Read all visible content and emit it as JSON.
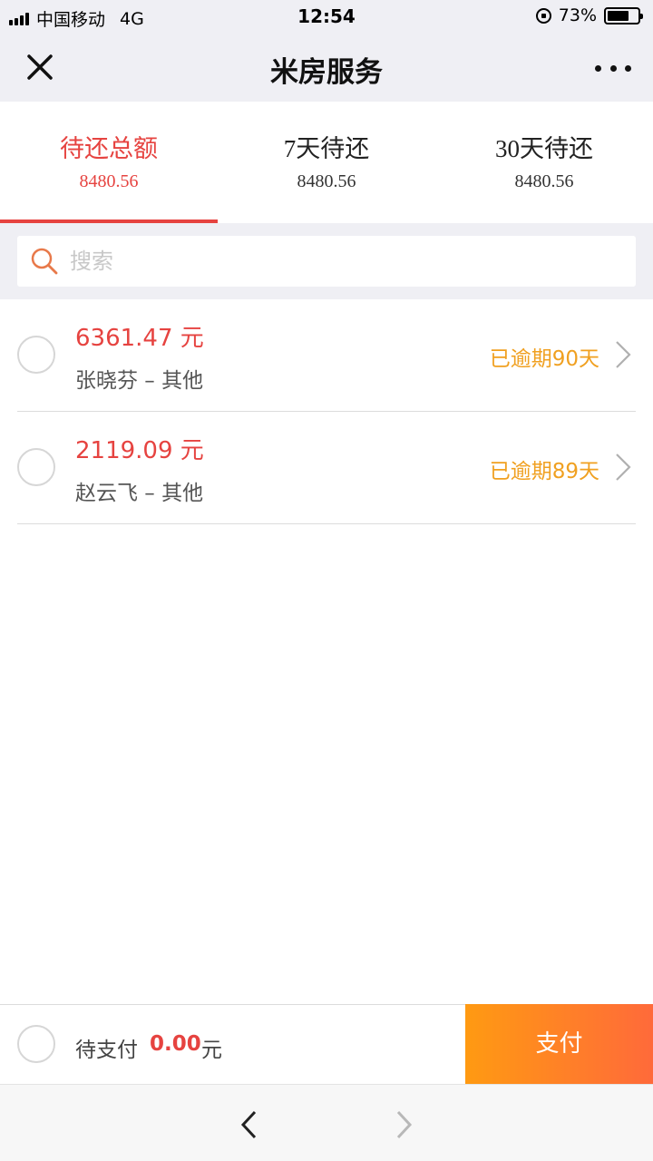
{
  "status_bar": {
    "carrier": "中国移动",
    "network": "4G",
    "time": "12:54",
    "battery": "73%",
    "battery_level": 0.73
  },
  "nav": {
    "title": "米房服务",
    "close_icon": "close-icon",
    "more_icon": "more-icon"
  },
  "tabs": [
    {
      "label": "待还总额",
      "amount": "8480.56",
      "active": true
    },
    {
      "label": "7天待还",
      "amount": "8480.56",
      "active": false
    },
    {
      "label": "30天待还",
      "amount": "8480.56",
      "active": false
    }
  ],
  "search": {
    "placeholder": "搜索",
    "value": ""
  },
  "items": [
    {
      "amount": "6361.47 元",
      "name": "张晓芬 – 其他",
      "status": "已逾期90天"
    },
    {
      "amount": "2119.09 元",
      "name": "赵云飞 – 其他",
      "status": "已逾期89天"
    }
  ],
  "paybar": {
    "label": "待支付",
    "amount": "0.00",
    "unit": "元",
    "button": "支付"
  },
  "colors": {
    "accent_red": "#e64340",
    "status_orange": "#f0a020",
    "pay_gradient_start": "#ff9a12",
    "pay_gradient_end": "#ff6a3a"
  }
}
